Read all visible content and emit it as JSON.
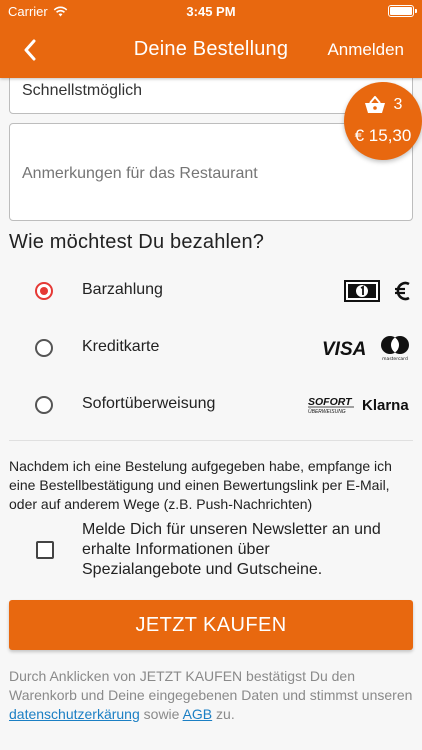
{
  "status_bar": {
    "carrier": "Carrier",
    "time": "3:45 PM"
  },
  "nav": {
    "title": "Deine Bestellung",
    "login_label": "Anmelden"
  },
  "delivery_time": {
    "value": "Schnellstmöglich"
  },
  "cart": {
    "count": "3",
    "total": "€ 15,30"
  },
  "notes": {
    "placeholder": "Anmerkungen für das Restaurant"
  },
  "payment": {
    "heading": "Wie möchtest Du bezahlen?",
    "options": [
      {
        "label": "Barzahlung",
        "selected": true,
        "logos": [
          "cash-icon",
          "euro-icon"
        ]
      },
      {
        "label": "Kreditkarte",
        "selected": false,
        "logos": [
          "VISA",
          "mastercard"
        ]
      },
      {
        "label": "Sofortüberweisung",
        "selected": false,
        "logos": [
          "SOFORT",
          "ÜBERWEISUNG",
          "Klarna"
        ]
      }
    ]
  },
  "consent_text": "Nachdem ich eine Bestelung aufgegeben habe, empfange ich eine Bestellbestätigung und einen Bewertungslink per E-Mail, oder auf anderem Wege (z.B. Push-Nachrichten)",
  "newsletter": {
    "label": "Melde Dich für unseren Newsletter an und erhalte Informationen über Spezialangebote und Gutscheine.",
    "checked": false
  },
  "buy_button": {
    "label": "JETZT KAUFEN"
  },
  "legal": {
    "text_before": "Durch Anklicken von JETZT KAUFEN bestätigst Du den Warenkorb und Deine eingegebenen Daten und stimmst unseren ",
    "privacy_link": "datenschutzerkärung",
    "text_middle": " sowie ",
    "terms_link": "AGB",
    "text_after": " zu."
  },
  "colors": {
    "brand": "#e8680f",
    "radio_selected": "#e53935",
    "link": "#1b7fc4"
  }
}
